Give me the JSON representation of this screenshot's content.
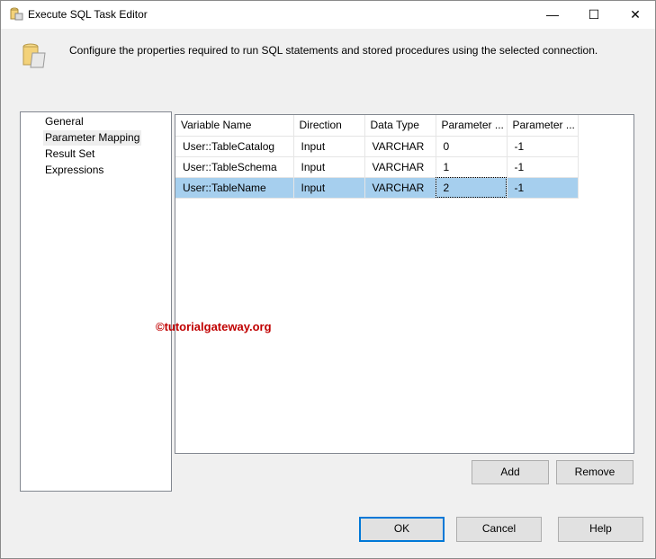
{
  "window": {
    "title": "Execute SQL Task Editor",
    "minimize": "—",
    "maximize": "☐",
    "close": "✕"
  },
  "description": "Configure the properties required to run SQL statements and stored procedures using the selected connection.",
  "nav": {
    "items": [
      "General",
      "Parameter Mapping",
      "Result Set",
      "Expressions"
    ],
    "selected": "Parameter Mapping"
  },
  "grid": {
    "columns": [
      "Variable Name",
      "Direction",
      "Data Type",
      "Parameter ...",
      "Parameter ..."
    ],
    "rows": [
      [
        "User::TableCatalog",
        "Input",
        "VARCHAR",
        "0",
        "-1"
      ],
      [
        "User::TableSchema",
        "Input",
        "VARCHAR",
        "1",
        "-1"
      ],
      [
        "User::TableName",
        "Input",
        "VARCHAR",
        "2",
        "-1"
      ]
    ]
  },
  "buttons": {
    "add": "Add",
    "remove": "Remove",
    "ok": "OK",
    "cancel": "Cancel",
    "help": "Help"
  },
  "watermark": "©tutorialgateway.org"
}
